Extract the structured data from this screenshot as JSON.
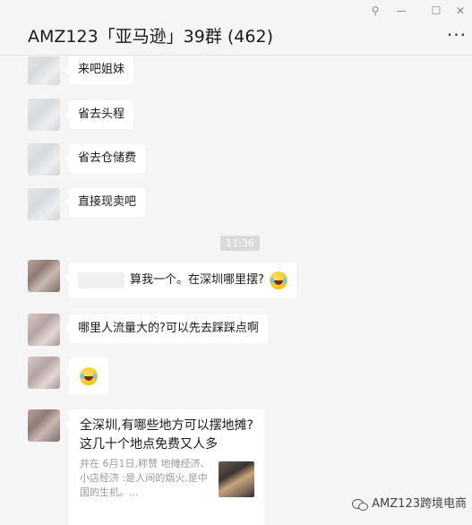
{
  "window": {
    "title": "AMZ123「亚马逊」39群 (462)",
    "pin_icon": "pin-icon",
    "minimize_icon": "minimize-icon",
    "maximize_icon": "maximize-icon",
    "close_icon": "close-icon",
    "more_label": "..."
  },
  "messages": [
    {
      "text": "来吧姐妹"
    },
    {
      "text": "省去头程"
    },
    {
      "text": "省去仓储费"
    },
    {
      "text": "直接现卖吧"
    },
    {
      "text": "算我一个。在深圳哪里摆?",
      "emoji": "laugh-cry-emoji"
    },
    {
      "text": "哪里人流量大的?可以先去踩踩点啊"
    },
    {
      "emoji": "laugh-cry-emoji"
    }
  ],
  "timestamp": "11:36",
  "link_card": {
    "title": "全深圳,有哪些地方可以摆地摊?这几十个地点免费又人多",
    "description": "并在 6月1日,称赞 地摊经济、小店经济 :是人间的烟火,是中国的生机。..."
  },
  "watermark": "AMZ123跨境电商"
}
